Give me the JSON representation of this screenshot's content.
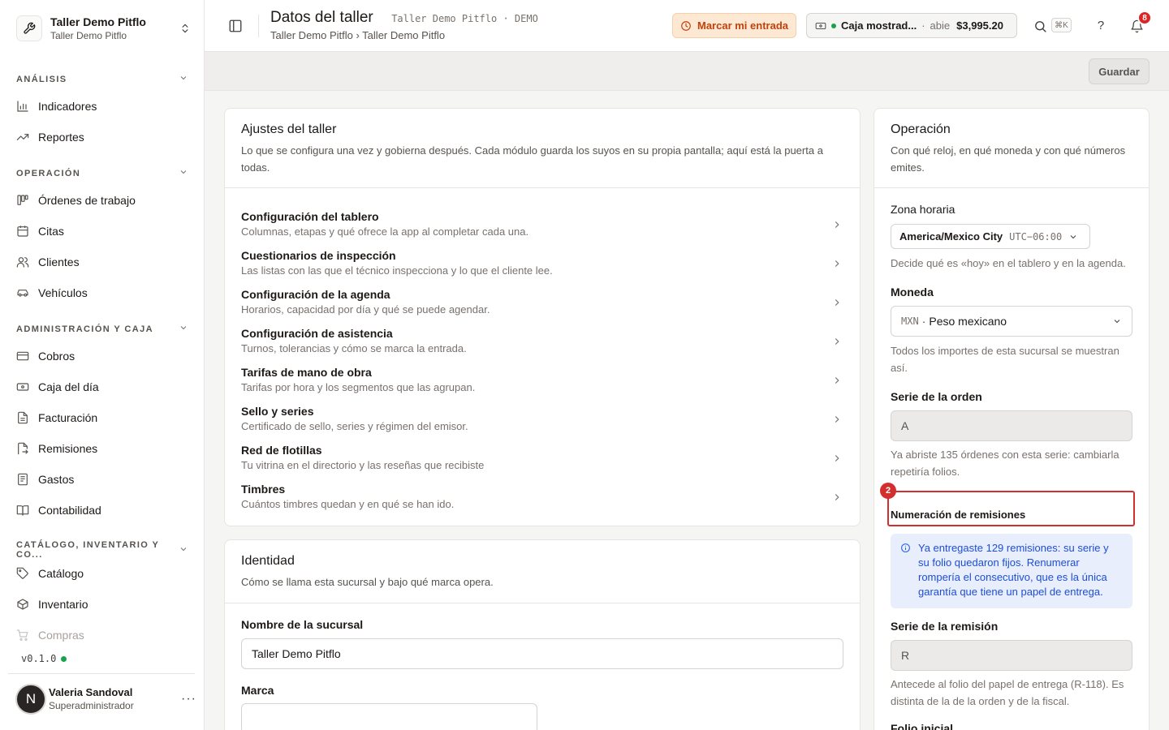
{
  "org": {
    "name": "Taller Demo Pitflo",
    "sub": "Taller Demo Pitflo"
  },
  "sidebar": {
    "sections": [
      {
        "label": "ANÁLISIS"
      },
      {
        "label": "OPERACIÓN"
      },
      {
        "label": "ADMINISTRACIÓN Y CAJA"
      },
      {
        "label": "CATÁLOGO, INVENTARIO Y CO..."
      }
    ],
    "items": [
      {
        "label": "Indicadores",
        "icon": "bar-chart-icon"
      },
      {
        "label": "Reportes",
        "icon": "trending-up-icon"
      },
      {
        "label": "Órdenes de trabajo",
        "icon": "kanban-icon"
      },
      {
        "label": "Citas",
        "icon": "calendar-icon"
      },
      {
        "label": "Clientes",
        "icon": "users-icon"
      },
      {
        "label": "Vehículos",
        "icon": "car-icon"
      },
      {
        "label": "Cobros",
        "icon": "credit-card-icon"
      },
      {
        "label": "Caja del día",
        "icon": "banknote-icon"
      },
      {
        "label": "Facturación",
        "icon": "file-text-icon"
      },
      {
        "label": "Remisiones",
        "icon": "file-export-icon"
      },
      {
        "label": "Gastos",
        "icon": "receipt-icon"
      },
      {
        "label": "Contabilidad",
        "icon": "book-icon"
      },
      {
        "label": "Catálogo",
        "icon": "tag-icon"
      },
      {
        "label": "Inventario",
        "icon": "package-icon"
      },
      {
        "label": "Compras",
        "icon": "cart-icon"
      }
    ],
    "version": "v0.1.0",
    "user": {
      "initial": "N",
      "name": "Valeria Sandoval",
      "role": "Superadministrador"
    }
  },
  "header": {
    "title": "Datos del taller",
    "subtitle": "Taller Demo Pitflo · DEMO",
    "breadcrumb": "Taller Demo Pitflo › Taller Demo Pitflo",
    "checkin_label": "Marcar mi entrada",
    "cash": {
      "name": "Caja mostrad...",
      "status": "abie",
      "amount": "$3,995.20"
    },
    "kbd": "⌘K",
    "help": "?",
    "notifications": "8"
  },
  "savebar": {
    "save_label": "Guardar"
  },
  "settings": {
    "title": "Ajustes del taller",
    "desc": "Lo que se configura una vez y gobierna después. Cada módulo guarda los suyos en su propia pantalla; aquí está la puerta a todas.",
    "items": [
      {
        "title": "Configuración del tablero",
        "desc": "Columnas, etapas y qué ofrece la app al completar cada una."
      },
      {
        "title": "Cuestionarios de inspección",
        "desc": "Las listas con las que el técnico inspecciona y lo que el cliente lee."
      },
      {
        "title": "Configuración de la agenda",
        "desc": "Horarios, capacidad por día y qué se puede agendar."
      },
      {
        "title": "Configuración de asistencia",
        "desc": "Turnos, tolerancias y cómo se marca la entrada."
      },
      {
        "title": "Tarifas de mano de obra",
        "desc": "Tarifas por hora y los segmentos que las agrupan."
      },
      {
        "title": "Sello y series",
        "desc": "Certificado de sello, series y régimen del emisor."
      },
      {
        "title": "Red de flotillas",
        "desc": "Tu vitrina en el directorio y las reseñas que recibiste"
      },
      {
        "title": "Timbres",
        "desc": "Cuántos timbres quedan y en qué se han ido."
      }
    ]
  },
  "identity": {
    "title": "Identidad",
    "desc": "Cómo se llama esta sucursal y bajo qué marca opera.",
    "branch_label": "Nombre de la sucursal",
    "branch_value": "Taller Demo Pitflo",
    "brand_label": "Marca",
    "brand_value": ""
  },
  "operation": {
    "title": "Operación",
    "desc": "Con qué reloj, en qué moneda y con qué números emites.",
    "tz_label": "Zona horaria",
    "tz_value": "America/Mexico City",
    "tz_offset": "UTC−06:00",
    "tz_help": "Decide qué es «hoy» en el tablero y en la agenda.",
    "currency_label": "Moneda",
    "currency_code": "MXN",
    "currency_name": "Peso mexicano",
    "currency_help": "Todos los importes de esta sucursal se muestran así.",
    "order_series_label": "Serie de la orden",
    "order_series_value": "A",
    "order_series_help": "Ya abriste 135 órdenes con esta serie: cambiarla repetiría folios.",
    "remission_numbering_label": "Numeración de remisiones",
    "highlight_number": "2",
    "remission_info": "Ya entregaste 129 remisiones: su serie y su folio quedaron fijos. Renumerar rompería el consecutivo, que es la única garantía que tiene un papel de entrega.",
    "remission_series_label": "Serie de la remisión",
    "remission_series_value": "R",
    "remission_series_help": "Antecede al folio del papel de entrega (R-118). Es distinta de la de la orden y de la fiscal.",
    "initial_folio_label": "Folio inicial"
  }
}
